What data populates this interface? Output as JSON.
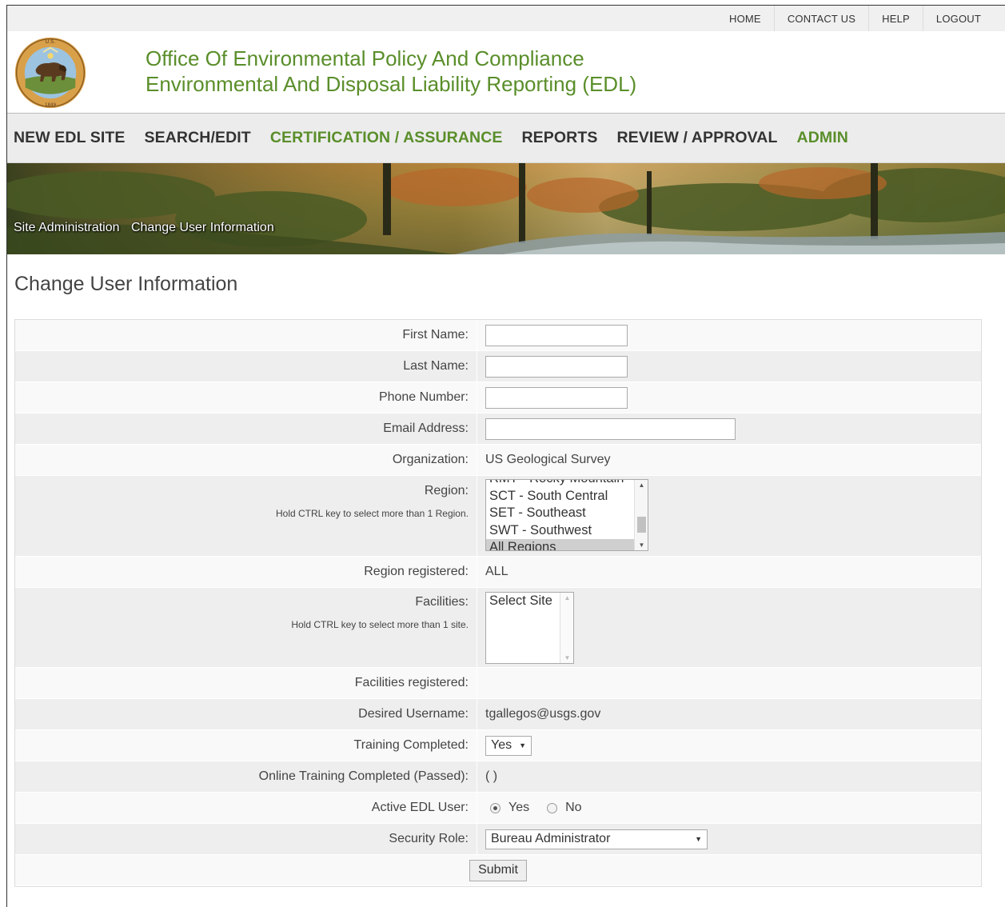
{
  "topnav": {
    "home": "HOME",
    "contact": "CONTACT US",
    "help": "HELP",
    "logout": "LOGOUT"
  },
  "header": {
    "title_line1": "Office Of Environmental Policy And Compliance",
    "title_line2": "Environmental And Disposal Liability Reporting (EDL)"
  },
  "mainnav": {
    "new_site": "NEW EDL SITE",
    "search_edit": "SEARCH/EDIT",
    "certification": "CERTIFICATION / ASSURANCE",
    "reports": "REPORTS",
    "review": "REVIEW / APPROVAL",
    "admin": "ADMIN"
  },
  "breadcrumb": {
    "level1": "Site Administration",
    "level2": "Change User Information"
  },
  "page_title": "Change User Information",
  "form": {
    "first_name_label": "First Name:",
    "first_name_value": "",
    "last_name_label": "Last Name:",
    "last_name_value": "",
    "phone_label": "Phone Number:",
    "phone_value": "",
    "email_label": "Email Address:",
    "email_value": "",
    "organization_label": "Organization:",
    "organization_value": "US Geological Survey",
    "region_label": "Region:",
    "region_hint": "Hold CTRL key to select more than 1 Region.",
    "region_options": [
      "RMT - Rocky Mountain",
      "SCT - South Central",
      "SET - Southeast",
      "SWT - Southwest",
      "All Regions"
    ],
    "region_registered_label": "Region registered:",
    "region_registered_value": "ALL",
    "facilities_label": "Facilities:",
    "facilities_hint": "Hold CTRL key to select more than 1 site.",
    "facilities_options": [
      "Select Site"
    ],
    "facilities_registered_label": "Facilities registered:",
    "facilities_registered_value": "",
    "username_label": "Desired Username:",
    "username_value": "tgallegos@usgs.gov",
    "training_label": "Training Completed:",
    "training_value": "Yes",
    "online_training_label": "Online Training Completed (Passed):",
    "online_training_value": "( )",
    "active_label": "Active EDL User:",
    "active_yes": "Yes",
    "active_no": "No",
    "security_role_label": "Security Role:",
    "security_role_value": "Bureau Administrator",
    "submit_label": "Submit"
  },
  "colors": {
    "brand_green": "#5a8e2a",
    "nav_bg": "#ececec",
    "row_odd": "#f9f9f9",
    "row_even": "#eeeeee"
  }
}
